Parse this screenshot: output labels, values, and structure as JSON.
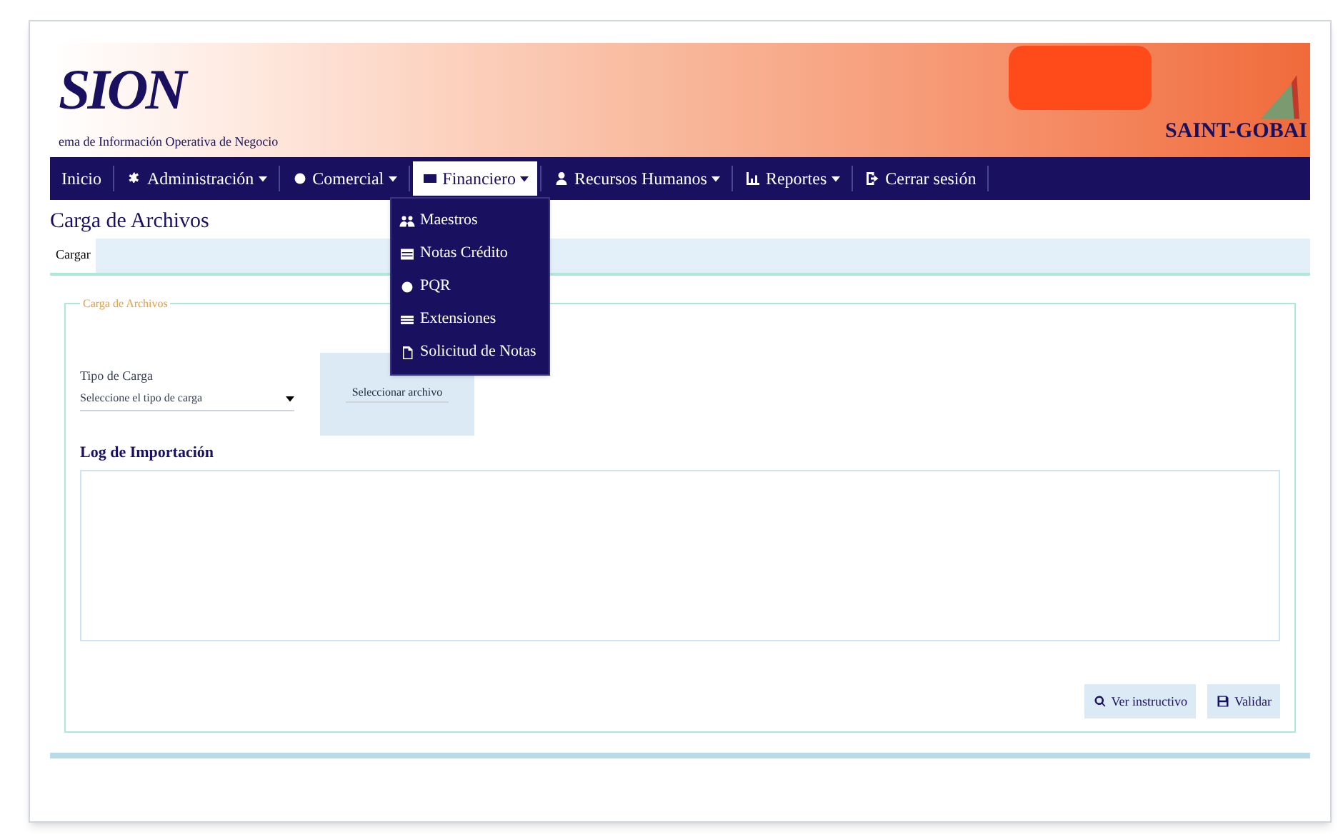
{
  "header": {
    "logo": "SION",
    "subtitle": "ema de Información Operativa de Negocio",
    "brand": "SAINT-GOBAI"
  },
  "menu": [
    {
      "label": "Inicio",
      "dropdown": false,
      "selected": false
    },
    {
      "label": "Administración",
      "dropdown": true,
      "selected": false
    },
    {
      "label": "Comercial",
      "dropdown": true,
      "selected": false
    },
    {
      "label": "Financiero",
      "dropdown": true,
      "selected": true
    },
    {
      "label": "Recursos Humanos",
      "dropdown": true,
      "selected": false
    },
    {
      "label": "Reportes",
      "dropdown": true,
      "selected": false
    },
    {
      "label": "Cerrar sesión",
      "dropdown": false,
      "selected": false
    }
  ],
  "submenu": [
    {
      "label": "Maestros"
    },
    {
      "label": "Notas Crédito"
    },
    {
      "label": "PQR"
    },
    {
      "label": "Extensiones"
    },
    {
      "label": "Solicitud de Notas"
    }
  ],
  "page": {
    "title": "Carga de Archivos",
    "tabs": [
      {
        "label": "Cargar",
        "selected": true
      }
    ],
    "legend": "Carga de Archivos",
    "type_label": "Tipo de Carga",
    "type_value": "Seleccione el tipo de carga",
    "file_button": "Seleccionar archivo",
    "log_label": "Log de Importación",
    "buttons": [
      {
        "label": "Ver instructivo"
      },
      {
        "label": "Validar"
      }
    ]
  }
}
